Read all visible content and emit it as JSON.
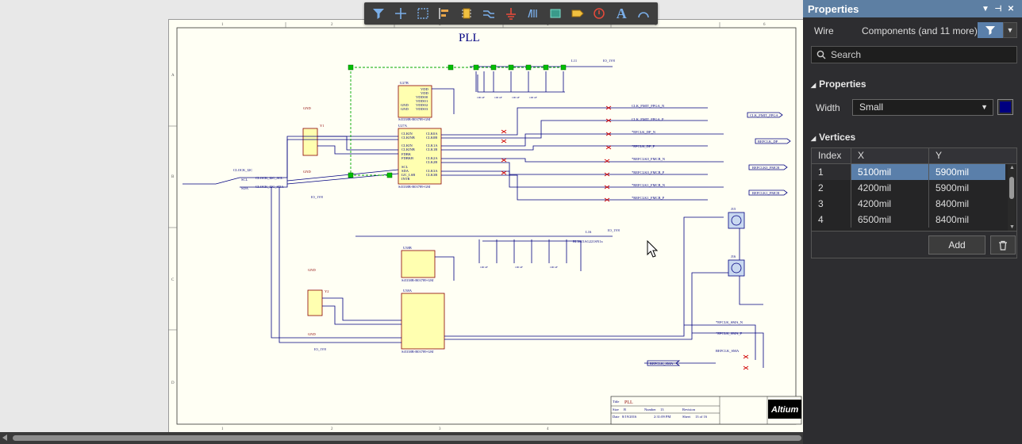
{
  "sheet": {
    "title": "PLL",
    "col_labels": [
      "1",
      "2",
      "3",
      "4",
      "5",
      "6"
    ],
    "row_labels": [
      "A",
      "B",
      "C",
      "D"
    ],
    "components": {
      "u1": {
        "top": "U27B",
        "bottom": "U27A",
        "part": "Si5338B-B03789-GM",
        "pins_top": [
          "VDD",
          "VDD",
          "VDDO0",
          "VDDO1",
          "VDDO2",
          "VDDO3",
          "GND",
          "GND"
        ],
        "pins_left": [
          "CLKIN",
          "CLKINB",
          "CLKIN",
          "CLKINB",
          "FDBK",
          "FDBKB",
          "SCL",
          "SDA",
          "I2C_LSB",
          "INTR"
        ],
        "pins_right": [
          "CLK0A",
          "CLK0B",
          "CLK1A",
          "CLK1B",
          "CLK2A",
          "CLK2B",
          "CLK3A",
          "CLK3B"
        ]
      },
      "u2": {
        "top": "U38B",
        "bottom": "U38A",
        "part": "Si5338B-B03789-GM"
      },
      "y1": {
        "ref": "Y1",
        "label": "GND"
      },
      "y2": {
        "ref": "Y2",
        "label": "GND"
      },
      "j1": {
        "ref": "J15"
      },
      "j2": {
        "ref": "J16"
      }
    },
    "nets": {
      "clock_i2c": "CLOCK_I2C",
      "scl": "SCL",
      "sda": "SDA",
      "clock_i2c_scl": "CLOCK_I2C_SCL",
      "clock_i2c_sda": "CLOCK_I2C_SDA",
      "io_1v8": "IO_1V8",
      "l1": "L11",
      "l2": "L16",
      "fmc_fpga_n": "CLK_FMIT_FPGA_N",
      "fmc_fpga_p": "CLK_FMIT_FPGA_P",
      "dp_n": "*EFCLK_DP_N",
      "dp_p": "*EFCLK_DP_P",
      "fmc0_n": "*REFCLK0_FMCB_N",
      "fmc0_p": "*REFCLK0_FMCB_P",
      "fmc1_n": "*REFCLK1_FMCB_N",
      "fmc1_p": "*REFCLK1_FMCB_P",
      "sma_n": "*EFCLK_SMA_N",
      "sma_p": "*EFCLK_SMA_P",
      "refclk_sma": "REFCLK_SMA",
      "ferrite": "BLM15AG221SN1x"
    },
    "port_labels": [
      "CLK_FMIT_FPGA",
      "REFCLK_DP",
      "REFCLK0_FMCB",
      "REFCLK1_FMCB",
      "REFCLK_SMA"
    ],
    "cap_values": [
      "100 nF",
      "100 nF",
      "100 nF",
      "100 nF",
      "100 nF",
      "100 nF",
      "100 nF"
    ],
    "title_block": {
      "title_label": "Title",
      "title_value": "PLL",
      "size_label": "Size",
      "size_value": "B",
      "number_label": "Number",
      "number_value": "13",
      "revision_label": "Revision",
      "date_label": "Date",
      "date_value": "8/19/2016",
      "time_value": "2:31:09 PM",
      "sheet_label": "Sheet",
      "sheet_value": "13 of 16",
      "logo": "Altium"
    }
  },
  "toolbar": {
    "buttons": [
      {
        "name": "filter-icon"
      },
      {
        "name": "crosshair-icon"
      },
      {
        "name": "select-rect-icon"
      },
      {
        "name": "align-icon"
      },
      {
        "name": "component-icon"
      },
      {
        "name": "wire-icon"
      },
      {
        "name": "power-port-icon"
      },
      {
        "name": "bus-icon"
      },
      {
        "name": "harness-icon"
      },
      {
        "name": "port-icon"
      },
      {
        "name": "no-erc-icon"
      },
      {
        "name": "text-icon"
      },
      {
        "name": "arc-icon"
      }
    ],
    "text_glyph": "A"
  },
  "panel": {
    "title": "Properties",
    "object_type": "Wire",
    "selection_scope": "Components (and 11 more)",
    "search_placeholder": "Search",
    "properties_section": "Properties",
    "width_label": "Width",
    "width_value": "Small",
    "wire_color": "#000080",
    "vertices_section": "Vertices",
    "columns": {
      "index": "Index",
      "x": "X",
      "y": "Y"
    },
    "vertices": [
      {
        "index": "1",
        "x": "5100mil",
        "y": "5900mil"
      },
      {
        "index": "2",
        "x": "4200mil",
        "y": "5900mil"
      },
      {
        "index": "3",
        "x": "4200mil",
        "y": "8400mil"
      },
      {
        "index": "4",
        "x": "6500mil",
        "y": "8400mil"
      }
    ],
    "add_label": "Add"
  },
  "colors": {
    "accent": "#5a7faa",
    "panel_header": "#5d7fa3",
    "wire": "#000080",
    "selection": "#00aa00",
    "component_fill": "#ffffb0",
    "component_border": "#8b0000"
  }
}
